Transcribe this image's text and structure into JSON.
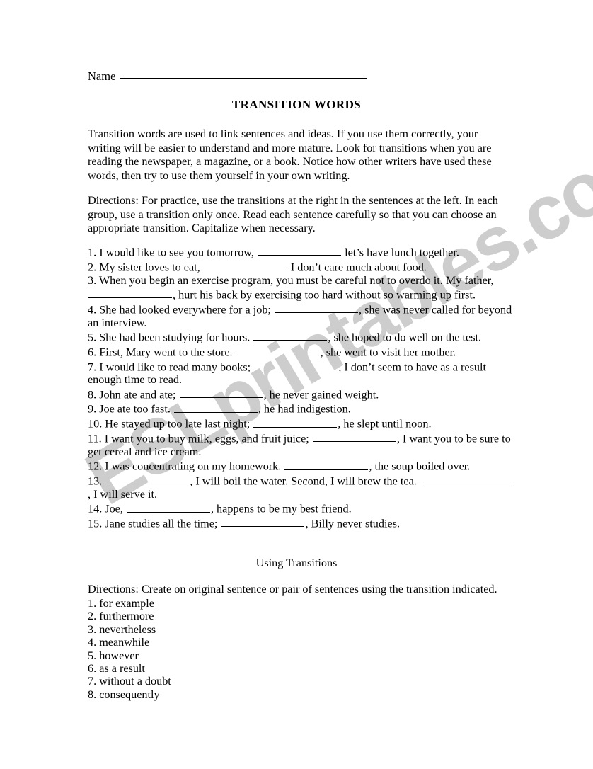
{
  "page": {
    "title": "TRANSITION WORDS",
    "watermark": "ESLprintables.com"
  },
  "name_field": {
    "label": "Name",
    "value": ""
  },
  "intro": {
    "paragraph": "Transition words are used to link sentences and ideas. If you use them correctly, your writing will be easier to understand and more mature. Look for transitions when you are reading the newspaper, a magazine, or a book. Notice how other writers have used these words, then try to use them yourself in your own writing."
  },
  "directions": {
    "paragraph": "Directions: For practice, use the transitions at the right in the sentences at the left. In each group, use a transition only once. Read each sentence carefully so that you can choose an appropriate transition. Capitalize when necessary."
  },
  "sentences": [
    {
      "number": "1.",
      "before": "I would like to see you tomorrow,",
      "after": "let’s have lunch together."
    },
    {
      "number": "2.",
      "before": "My sister loves to eat,",
      "after": "I don’t care much about food."
    },
    {
      "number": "3.",
      "before": "When you begin an exercise program, you must be careful not to overdo it. My father,",
      "after": ", hurt his back by exercising too hard without so warming up first."
    },
    {
      "number": "4.",
      "before": "She had looked everywhere for a job;",
      "after": ", she was never called for beyond an interview."
    },
    {
      "number": "5.",
      "before": "She had been studying for hours.",
      "after": ", she hoped to do well on the test."
    },
    {
      "number": "6.",
      "before": "First, Mary went to the store.",
      "after": ", she went to visit her mother."
    },
    {
      "number": "7.",
      "before": "I would like to read many books;",
      "after": ", I don’t seem to have as a result enough time to read."
    },
    {
      "number": "8.",
      "before": "John ate and ate;",
      "after": ", he never gained weight."
    },
    {
      "number": "9.",
      "before": "Joe ate too fast.",
      "after": ", he had indigestion."
    },
    {
      "number": "10.",
      "before": "He stayed up too late last night;",
      "after": ", he slept until noon."
    },
    {
      "number": "11.",
      "before": "I want you to buy milk, eggs, and fruit juice;",
      "after": ", I want you to be sure to get cereal and ice cream."
    },
    {
      "number": "12.",
      "before": "I was concentrating on my homework.",
      "after": ", the soup boiled over."
    },
    {
      "number": "13.",
      "before": "",
      "middle": ", I will boil the water. Second, I will brew the tea.",
      "after": ", I will serve it."
    },
    {
      "number": "14.",
      "before": "Joe,",
      "after": ", happens to be my best friend."
    },
    {
      "number": "15.",
      "before": "Jane studies all the time;",
      "after": ", Billy never studies."
    }
  ],
  "using_transitions": {
    "heading": "Using Transitions",
    "directions": "Directions: Create on original sentence or pair of sentences using the transition indicated.",
    "words": [
      {
        "number": "1.",
        "word": "for example"
      },
      {
        "number": "2.",
        "word": "furthermore"
      },
      {
        "number": "3.",
        "word": "nevertheless"
      },
      {
        "number": "4.",
        "word": "meanwhile"
      },
      {
        "number": "5.",
        "word": "however"
      },
      {
        "number": "6.",
        "word": "as a result"
      },
      {
        "number": "7.",
        "word": "without a doubt"
      },
      {
        "number": "8.",
        "word": "consequently"
      }
    ]
  }
}
